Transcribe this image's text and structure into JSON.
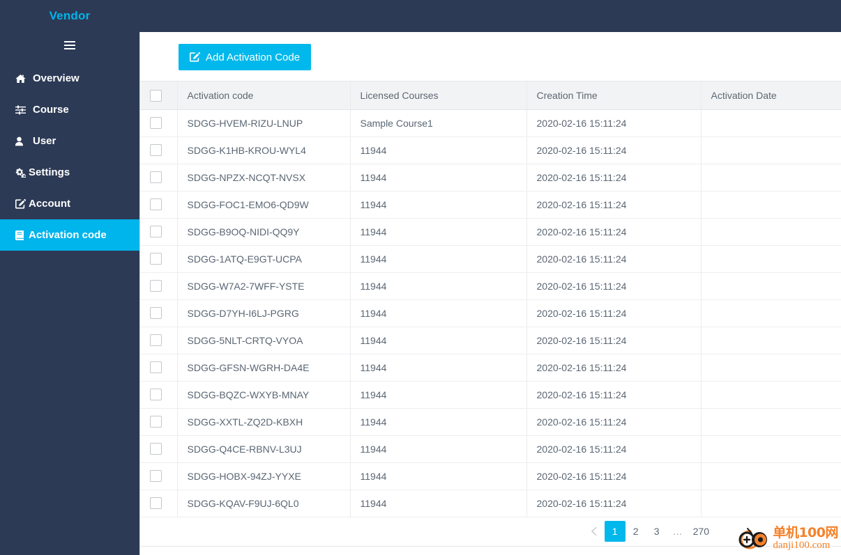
{
  "brand": {
    "title": "Vendor"
  },
  "sidebar": {
    "menu_icon": "hamburger-icon",
    "items": [
      {
        "label": "Overview",
        "icon": "home-icon",
        "active": false
      },
      {
        "label": "Course",
        "icon": "sliders-icon",
        "active": false
      },
      {
        "label": "User",
        "icon": "user-icon",
        "active": false
      },
      {
        "label": "Settings",
        "icon": "cogs-icon",
        "active": false
      },
      {
        "label": "Account",
        "icon": "pen-square-icon",
        "active": false
      },
      {
        "label": "Activation code",
        "icon": "book-icon",
        "active": true
      }
    ]
  },
  "toolbar": {
    "add_label": "Add Activation Code",
    "add_icon": "pen-square-icon"
  },
  "table": {
    "columns": [
      "",
      "Activation code",
      "Licensed Courses",
      "Creation Time",
      "Activation Date",
      ""
    ],
    "rows": [
      {
        "code": "SDGG-HVEM-RIZU-LNUP",
        "licensed": "Sample Course1",
        "created": "2020-02-16 15:11:24",
        "activated": ""
      },
      {
        "code": "SDGG-K1HB-KROU-WYL4",
        "licensed": "11944",
        "created": "2020-02-16 15:11:24",
        "activated": ""
      },
      {
        "code": "SDGG-NPZX-NCQT-NVSX",
        "licensed": "11944",
        "created": "2020-02-16 15:11:24",
        "activated": ""
      },
      {
        "code": "SDGG-FOC1-EMO6-QD9W",
        "licensed": "11944",
        "created": "2020-02-16 15:11:24",
        "activated": ""
      },
      {
        "code": "SDGG-B9OQ-NIDI-QQ9Y",
        "licensed": "11944",
        "created": "2020-02-16 15:11:24",
        "activated": ""
      },
      {
        "code": "SDGG-1ATQ-E9GT-UCPA",
        "licensed": "11944",
        "created": "2020-02-16 15:11:24",
        "activated": ""
      },
      {
        "code": "SDGG-W7A2-7WFF-YSTE",
        "licensed": "11944",
        "created": "2020-02-16 15:11:24",
        "activated": ""
      },
      {
        "code": "SDGG-D7YH-I6LJ-PGRG",
        "licensed": "11944",
        "created": "2020-02-16 15:11:24",
        "activated": ""
      },
      {
        "code": "SDGG-5NLT-CRTQ-VYOA",
        "licensed": "11944",
        "created": "2020-02-16 15:11:24",
        "activated": ""
      },
      {
        "code": "SDGG-GFSN-WGRH-DA4E",
        "licensed": "11944",
        "created": "2020-02-16 15:11:24",
        "activated": ""
      },
      {
        "code": "SDGG-BQZC-WXYB-MNAY",
        "licensed": "11944",
        "created": "2020-02-16 15:11:24",
        "activated": ""
      },
      {
        "code": "SDGG-XXTL-ZQ2D-KBXH",
        "licensed": "11944",
        "created": "2020-02-16 15:11:24",
        "activated": ""
      },
      {
        "code": "SDGG-Q4CE-RBNV-L3UJ",
        "licensed": "11944",
        "created": "2020-02-16 15:11:24",
        "activated": ""
      },
      {
        "code": "SDGG-HOBX-94ZJ-YYXE",
        "licensed": "11944",
        "created": "2020-02-16 15:11:24",
        "activated": ""
      },
      {
        "code": "SDGG-KQAV-F9UJ-6QL0",
        "licensed": "11944",
        "created": "2020-02-16 15:11:24",
        "activated": ""
      }
    ]
  },
  "pagination": {
    "prev_icon": "chevron-left-icon",
    "pages": [
      "1",
      "2",
      "3",
      "…",
      "270"
    ],
    "current": "1"
  },
  "watermark": {
    "cn": "单机100网",
    "en": "danji100.com"
  },
  "colors": {
    "sidebar_bg": "#2c3a55",
    "accent": "#00b8ec",
    "brand_text": "#00b4ec",
    "watermark": "#f4822a"
  }
}
